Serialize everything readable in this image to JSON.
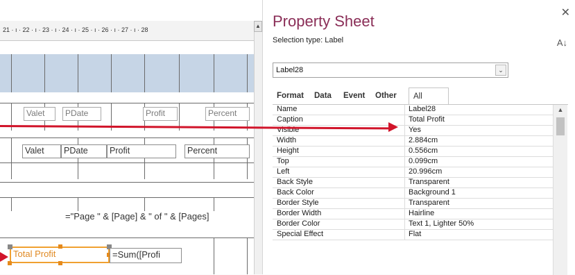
{
  "ruler": {
    "marks": [
      "21 · ı · 22 · ı · 23 · ı · 24 · ı · 25 · ı · 26 · ı · 27 · ı · 28"
    ]
  },
  "design": {
    "detail_labels": [
      "Valet",
      "PDate",
      "Profit",
      "Percent"
    ],
    "detail_fields": [
      "Valet",
      "PDate",
      "Profit",
      "Percent"
    ],
    "page_footer_expr": "=\"Page \" & [Page] & \" of \" & [Pages]",
    "total_label": "Total Profit",
    "total_expr": "=Sum([Profi"
  },
  "sheet": {
    "title": "Property Sheet",
    "selection_type": "Selection type:  Label",
    "object_combo": "Label28",
    "tabs": [
      "Format",
      "Data",
      "Event",
      "Other",
      "All"
    ],
    "active_tab": "All",
    "properties": [
      {
        "name": "Name",
        "value": "Label28"
      },
      {
        "name": "Caption",
        "value": "Total Profit"
      },
      {
        "name": "Visible",
        "value": "Yes"
      },
      {
        "name": "Width",
        "value": "2.884cm"
      },
      {
        "name": "Height",
        "value": "0.556cm"
      },
      {
        "name": "Top",
        "value": "0.099cm"
      },
      {
        "name": "Left",
        "value": "20.996cm"
      },
      {
        "name": "Back Style",
        "value": "Transparent"
      },
      {
        "name": "Back Color",
        "value": "Background 1"
      },
      {
        "name": "Border Style",
        "value": "Transparent"
      },
      {
        "name": "Border Width",
        "value": "Hairline"
      },
      {
        "name": "Border Color",
        "value": "Text 1, Lighter 50%"
      },
      {
        "name": "Special Effect",
        "value": "Flat"
      }
    ]
  },
  "colors": {
    "title": "#8a2e57",
    "arrow": "#d1142a",
    "selection": "#f0a030",
    "header_band": "#c6d5e6"
  },
  "icons": {
    "close": "close-icon",
    "sort": "sort-az-icon",
    "dropdown": "chevron-down-icon",
    "scroll_up": "scroll-up-icon"
  }
}
